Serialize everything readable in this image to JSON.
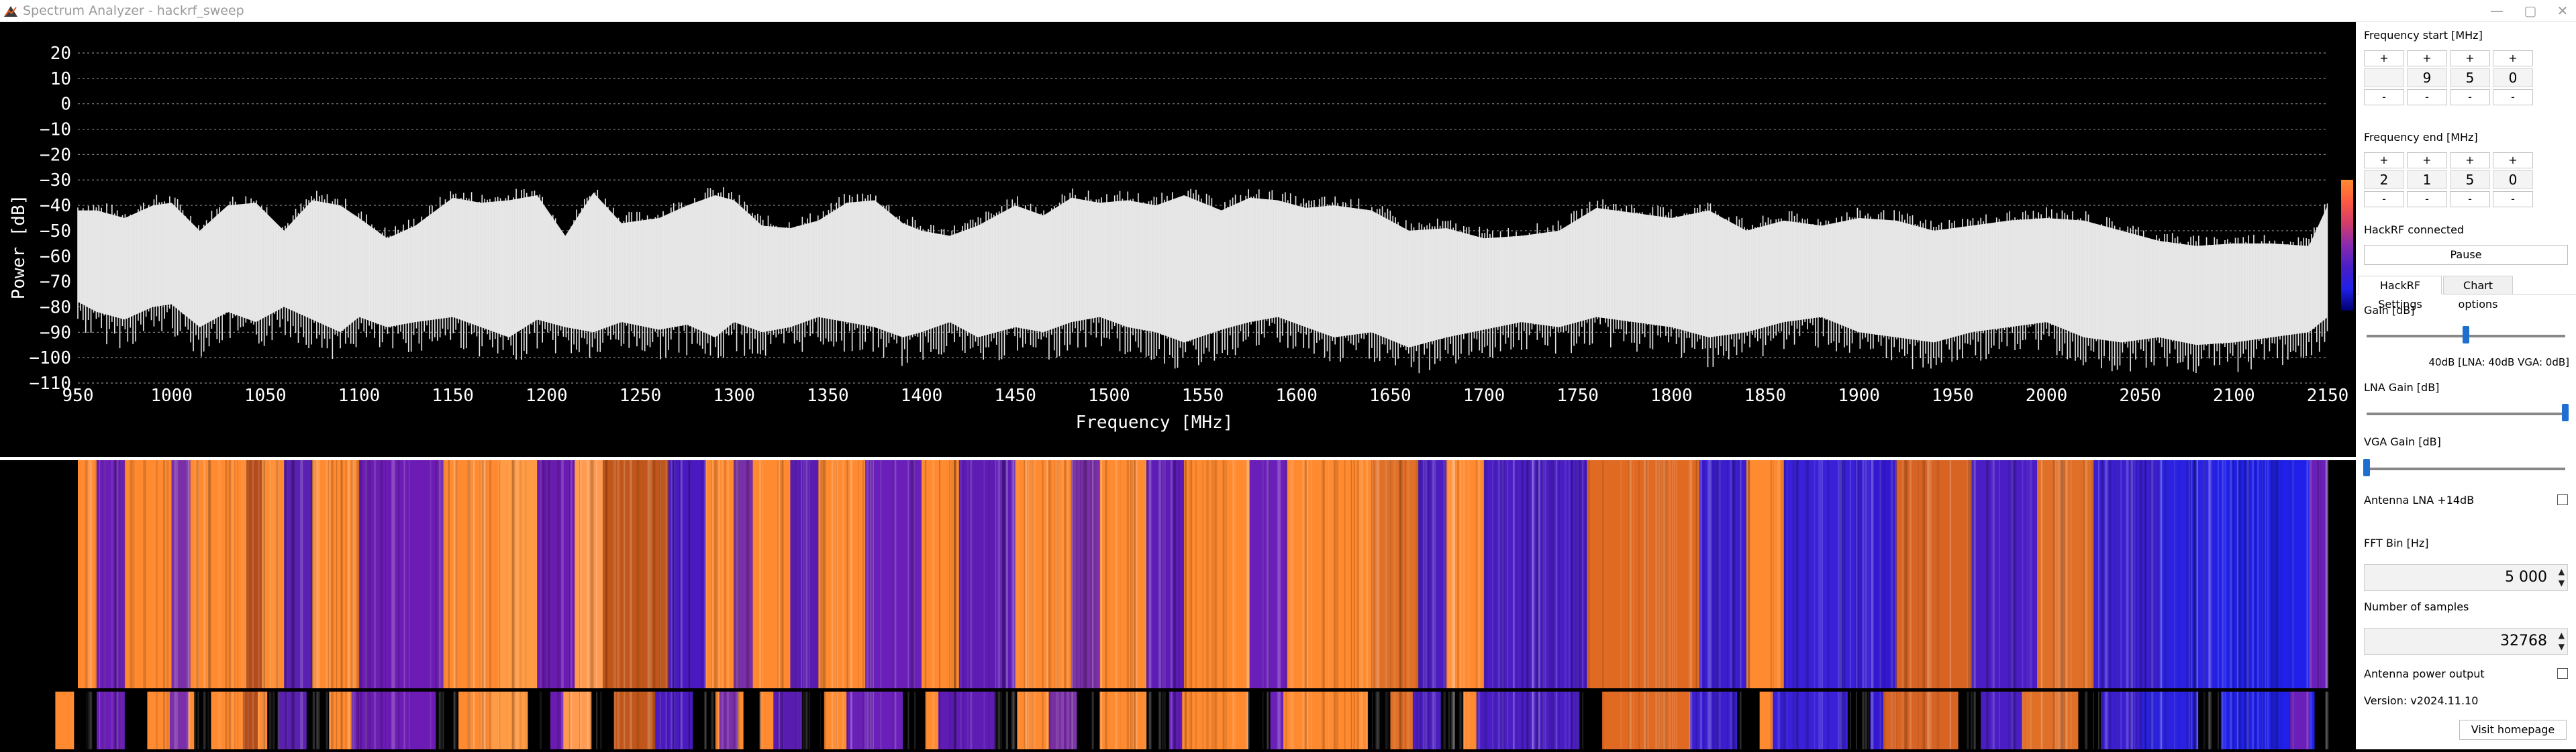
{
  "window": {
    "title": "Spectrum Analyzer - hackrf_sweep",
    "controls": [
      "—",
      "▢",
      "✕"
    ]
  },
  "chart_data": {
    "type": "line",
    "title": "",
    "xlabel": "Frequency [MHz]",
    "ylabel": "Power [dB]",
    "xlim": [
      950,
      2150
    ],
    "ylim": [
      -110,
      20
    ],
    "x_ticks": [
      "950",
      "1000",
      "1050",
      "1100",
      "1150",
      "1200",
      "1250",
      "1300",
      "1350",
      "1400",
      "1450",
      "1500",
      "1550",
      "1600",
      "1650",
      "1700",
      "1750",
      "1800",
      "1850",
      "1900",
      "1950",
      "2000",
      "2050",
      "2100",
      "2150"
    ],
    "y_ticks": [
      "20",
      "10",
      "0",
      "−10",
      "−20",
      "−30",
      "−40",
      "−50",
      "−60",
      "−70",
      "−80",
      "−90",
      "−100",
      "−110"
    ],
    "grid": "horizontal dotted",
    "series": [
      {
        "x": [
          950,
          960,
          975,
          990,
          1000,
          1015,
          1030,
          1045,
          1060,
          1075,
          1090,
          1100,
          1115,
          1130,
          1150,
          1165,
          1180,
          1195,
          1210,
          1225,
          1240,
          1260,
          1275,
          1290,
          1300,
          1315,
          1330,
          1345,
          1360,
          1375,
          1390,
          1400,
          1415,
          1430,
          1450,
          1465,
          1480,
          1495,
          1510,
          1525,
          1540,
          1560,
          1575,
          1590,
          1605,
          1620,
          1640,
          1660,
          1680,
          1700,
          1720,
          1740,
          1760,
          1780,
          1800,
          1820,
          1840,
          1860,
          1880,
          1900,
          1920,
          1940,
          1960,
          1980,
          2000,
          2020,
          2040,
          2060,
          2080,
          2100,
          2120,
          2140,
          2150
        ],
        "max": [
          -42,
          -42,
          -45,
          -40,
          -39,
          -50,
          -40,
          -39,
          -50,
          -38,
          -40,
          -45,
          -53,
          -48,
          -37,
          -39,
          -38,
          -36,
          -52,
          -35,
          -47,
          -45,
          -40,
          -36,
          -38,
          -48,
          -49,
          -46,
          -39,
          -38,
          -47,
          -50,
          -52,
          -48,
          -40,
          -44,
          -37,
          -39,
          -38,
          -40,
          -36,
          -42,
          -37,
          -38,
          -41,
          -40,
          -42,
          -50,
          -49,
          -53,
          -52,
          -50,
          -41,
          -43,
          -45,
          -42,
          -50,
          -46,
          -48,
          -45,
          -46,
          -50,
          -48,
          -46,
          -45,
          -46,
          -50,
          -54,
          -56,
          -55,
          -55,
          -56,
          -40
        ],
        "min": [
          -78,
          -82,
          -85,
          -80,
          -79,
          -88,
          -82,
          -86,
          -80,
          -85,
          -90,
          -84,
          -88,
          -86,
          -84,
          -88,
          -92,
          -85,
          -88,
          -90,
          -86,
          -89,
          -87,
          -92,
          -86,
          -90,
          -88,
          -84,
          -86,
          -88,
          -92,
          -90,
          -86,
          -92,
          -88,
          -90,
          -86,
          -84,
          -88,
          -90,
          -94,
          -89,
          -86,
          -84,
          -88,
          -92,
          -90,
          -96,
          -92,
          -89,
          -86,
          -88,
          -84,
          -86,
          -88,
          -92,
          -90,
          -86,
          -84,
          -90,
          -92,
          -94,
          -90,
          -88,
          -86,
          -92,
          -94,
          -92,
          -95,
          -94,
          -92,
          -90,
          -84
        ]
      }
    ]
  },
  "waterfall": {
    "bands": [
      [
        950,
        960,
        "#ff8a30"
      ],
      [
        960,
        975,
        "#6b1db8"
      ],
      [
        975,
        1000,
        "#ff8a30"
      ],
      [
        1000,
        1010,
        "#7a2fa8"
      ],
      [
        1010,
        1040,
        "#ff8a30"
      ],
      [
        1040,
        1048,
        "#b34c1a"
      ],
      [
        1048,
        1060,
        "#ff8a30"
      ],
      [
        1060,
        1075,
        "#5a20b0"
      ],
      [
        1075,
        1100,
        "#ff8a30"
      ],
      [
        1100,
        1145,
        "#6c1cb4"
      ],
      [
        1145,
        1175,
        "#ff8a30"
      ],
      [
        1175,
        1195,
        "#ff9a45"
      ],
      [
        1195,
        1215,
        "#6a1cb0"
      ],
      [
        1215,
        1230,
        "#ff9a50"
      ],
      [
        1230,
        1265,
        "#c0561a"
      ],
      [
        1265,
        1285,
        "#4a1ac0"
      ],
      [
        1285,
        1300,
        "#ff8a30"
      ],
      [
        1300,
        1310,
        "#7a2fa8"
      ],
      [
        1310,
        1330,
        "#ff8a30"
      ],
      [
        1330,
        1345,
        "#5a1cb0"
      ],
      [
        1345,
        1370,
        "#ff8a30"
      ],
      [
        1370,
        1400,
        "#6a1fb8"
      ],
      [
        1400,
        1420,
        "#ff8a30"
      ],
      [
        1420,
        1450,
        "#5e1cb4"
      ],
      [
        1450,
        1480,
        "#ff8a30"
      ],
      [
        1480,
        1495,
        "#7a2fa8"
      ],
      [
        1495,
        1520,
        "#ff8a30"
      ],
      [
        1520,
        1540,
        "#5e1cb4"
      ],
      [
        1540,
        1575,
        "#ff8a30"
      ],
      [
        1575,
        1595,
        "#6a1fb8"
      ],
      [
        1595,
        1640,
        "#ff8a30"
      ],
      [
        1640,
        1665,
        "#e07028"
      ],
      [
        1665,
        1680,
        "#4b1ec0"
      ],
      [
        1680,
        1700,
        "#ff8a30"
      ],
      [
        1700,
        1755,
        "#4a1ec4"
      ],
      [
        1755,
        1815,
        "#e06a22"
      ],
      [
        1815,
        1840,
        "#3c1ed0"
      ],
      [
        1840,
        1860,
        "#ff8a30"
      ],
      [
        1860,
        1900,
        "#3a20d8"
      ],
      [
        1900,
        1920,
        "#3418d0"
      ],
      [
        1920,
        1960,
        "#d86424"
      ],
      [
        1960,
        1995,
        "#4a1ec4"
      ],
      [
        1995,
        2025,
        "#e07028"
      ],
      [
        2025,
        2060,
        "#3b1ed0"
      ],
      [
        2060,
        2090,
        "#2a22e0"
      ],
      [
        2090,
        2140,
        "#2020e8"
      ],
      [
        2140,
        2150,
        "#6a1fb8"
      ]
    ],
    "colorbar": [
      "#ff8a30",
      "#ff5a40",
      "#d23c6a",
      "#8a2ab0",
      "#4a1ec8",
      "#2020e8",
      "#000070"
    ]
  },
  "panel": {
    "freq_start": {
      "label": "Frequency start [MHz]",
      "plus": [
        "+",
        "+",
        "+",
        "+"
      ],
      "digits": [
        "",
        "9",
        "5",
        "0"
      ],
      "minus": [
        "-",
        "-",
        "-",
        "-"
      ]
    },
    "freq_end": {
      "label": "Frequency end [MHz]",
      "plus": [
        "+",
        "+",
        "+",
        "+"
      ],
      "digits": [
        "2",
        "1",
        "5",
        "0"
      ],
      "minus": [
        "-",
        "-",
        "-",
        "-"
      ]
    },
    "status": "HackRF connected",
    "pause_label": "Pause",
    "tabs": [
      "HackRF Settings",
      "Chart options"
    ],
    "gain": {
      "label": "Gain [dB]",
      "value_text": "40dB  [LNA: 40dB  VGA: 0dB]",
      "level": 0.5
    },
    "lna_gain": {
      "label": "LNA Gain [dB]",
      "level": 1.0
    },
    "vga_gain": {
      "label": "VGA Gain [dB]",
      "level": 0.0
    },
    "antenna_lna_label": "Antenna LNA +14dB",
    "fft_bin": {
      "label": "FFT Bin [Hz]",
      "value": "5 000"
    },
    "samples": {
      "label": "Number of samples",
      "value": "32768"
    },
    "antenna_power_label": "Antenna power output",
    "version": "Version: v2024.11.10",
    "visit_label": "Visit homepage"
  }
}
